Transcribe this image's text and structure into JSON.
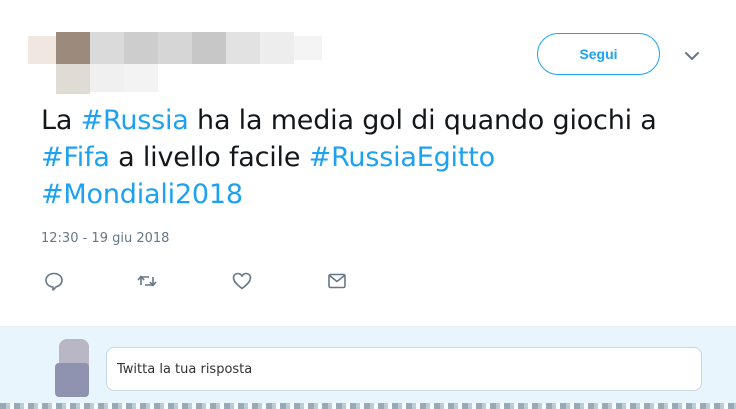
{
  "header": {
    "follow_label": "Segui",
    "menu_icon": "chevron-down-icon"
  },
  "tweet": {
    "segments": [
      {
        "text": "La ",
        "hashtag": false
      },
      {
        "text": "#Russia",
        "hashtag": true
      },
      {
        "text": " ha la media gol di quando giochi a ",
        "hashtag": false
      },
      {
        "text": "#Fifa",
        "hashtag": true
      },
      {
        "text": " a livello facile ",
        "hashtag": false
      },
      {
        "text": "#RussiaEgitto",
        "hashtag": true
      },
      {
        "text": " ",
        "hashtag": false
      },
      {
        "text": "#Mondiali2018",
        "hashtag": true
      }
    ],
    "timestamp": "12:30 - 19 giu 2018"
  },
  "actions": [
    {
      "name": "reply-icon"
    },
    {
      "name": "retweet-icon"
    },
    {
      "name": "like-icon"
    },
    {
      "name": "direct-message-icon"
    }
  ],
  "reply": {
    "placeholder": "Twitta la tua risposta"
  },
  "colors": {
    "accent": "#1da1f2",
    "text": "#14171a",
    "muted": "#657786",
    "reply_bg": "#e8f5fd"
  }
}
